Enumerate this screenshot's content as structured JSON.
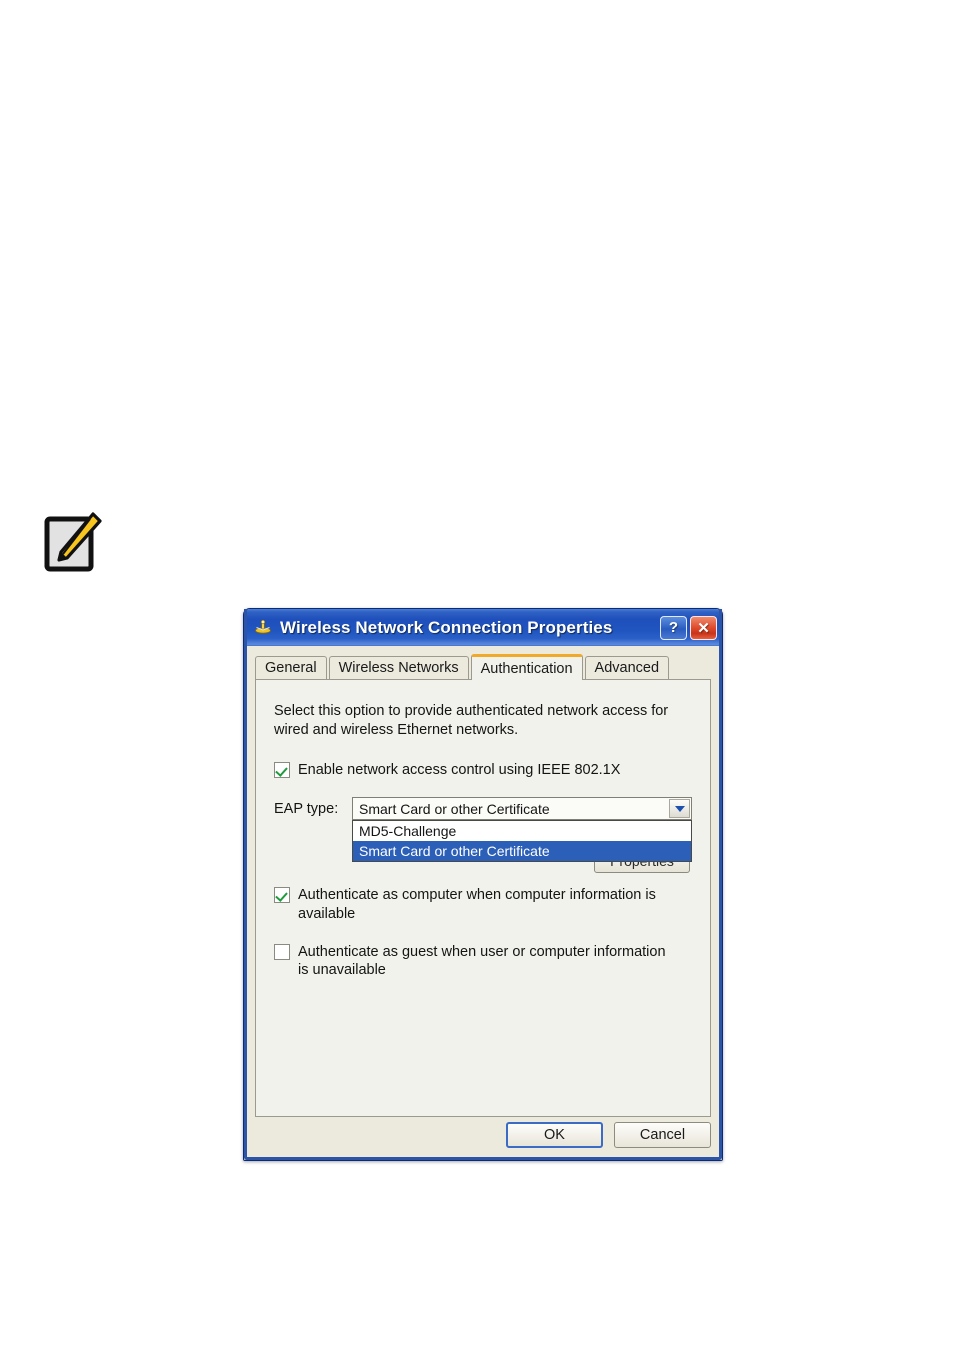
{
  "page": {
    "note_icon": "note-pencil-icon"
  },
  "dialog": {
    "title": "Wireless Network Connection Properties",
    "title_icon": "network-adapter-icon",
    "help_button": "?",
    "close_button": "✕",
    "tabs": [
      {
        "label": "General",
        "active": false
      },
      {
        "label": "Wireless Networks",
        "active": false
      },
      {
        "label": "Authentication",
        "active": true
      },
      {
        "label": "Advanced",
        "active": false
      }
    ],
    "panel": {
      "description": "Select this option to provide authenticated network access for wired and wireless Ethernet networks.",
      "enable_checkbox": {
        "label": "Enable network access control using IEEE 802.1X",
        "checked": true
      },
      "eap": {
        "label": "EAP type:",
        "value": "Smart Card or other Certificate",
        "expanded": true,
        "options": [
          {
            "label": "MD5-Challenge",
            "selected": false
          },
          {
            "label": "Smart Card or other Certificate",
            "selected": true
          }
        ]
      },
      "properties_button": "Properties",
      "auth_computer_checkbox": {
        "label": "Authenticate as computer when computer information is available",
        "checked": true
      },
      "auth_guest_checkbox": {
        "label": "Authenticate as guest when user or computer information is unavailable",
        "checked": false
      }
    },
    "footer": {
      "ok": "OK",
      "cancel": "Cancel"
    }
  },
  "colors": {
    "titlebar_blue": "#2055bf",
    "active_tab_accent": "#f0a92b",
    "selection_blue": "#2b5fb8",
    "check_green": "#1f9b3d",
    "close_red": "#df4a2b",
    "dialog_face": "#ece9dd",
    "panel_face": "#f2f2ec"
  }
}
